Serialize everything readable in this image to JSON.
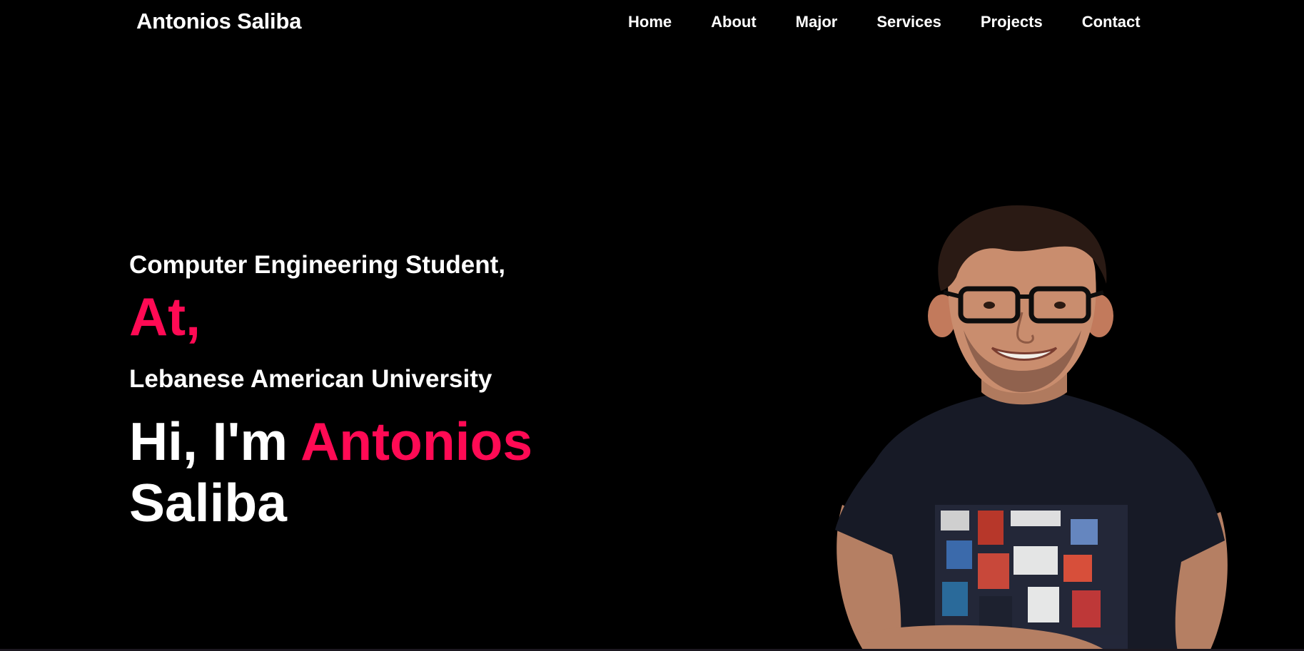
{
  "header": {
    "logo": "Antonios Saliba"
  },
  "nav": {
    "items": [
      "Home",
      "About",
      "Major",
      "Services",
      "Projects",
      "Contact"
    ]
  },
  "hero": {
    "line1": "Computer Engineering Student,",
    "line2": "At,",
    "line3": "Lebanese American University",
    "greeting_prefix": "Hi, I'm ",
    "greeting_name_accent": "Antonios",
    "greeting_name_rest": "Saliba"
  },
  "colors": {
    "background": "#000000",
    "text": "#ffffff",
    "accent": "#ff0a54"
  },
  "portrait": {
    "icon": "person-portrait-photo"
  }
}
